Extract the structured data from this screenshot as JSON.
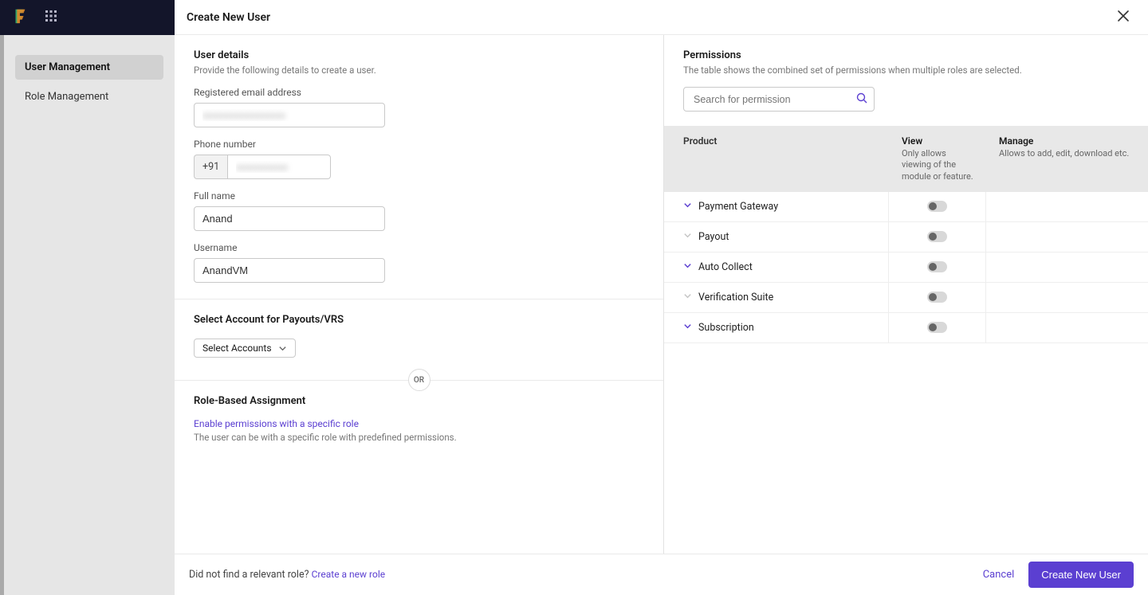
{
  "sidebar": {
    "items": [
      {
        "label": "User Management",
        "active": true
      },
      {
        "label": "Role Management",
        "active": false
      }
    ]
  },
  "modal": {
    "title": "Create New User",
    "left": {
      "user_details": {
        "title": "User details",
        "subtitle": "Provide the following details to create a user.",
        "email_label": "Registered email address",
        "email_value": "xxxxxxxxxxxxxxxx",
        "phone_label": "Phone number",
        "phone_prefix": "+91",
        "phone_value": "xxxxxxxxxx",
        "fullname_label": "Full name",
        "fullname_value": "Anand",
        "username_label": "Username",
        "username_value": "AnandVM"
      },
      "accounts": {
        "title": "Select Account for Payouts/VRS",
        "select_label": "Select Accounts"
      },
      "or_label": "OR",
      "role": {
        "title": "Role-Based Assignment",
        "link": "Enable permissions with a specific role",
        "note": "The user can be with a specific role with predefined permissions."
      }
    },
    "right": {
      "title": "Permissions",
      "subtitle": "The table shows the combined set of permissions when multiple roles are selected.",
      "search_placeholder": "Search for permission",
      "columns": {
        "product": "Product",
        "view": "View",
        "view_sub": "Only allows viewing of the module or feature.",
        "manage": "Manage",
        "manage_sub": "Allows to add, edit, download etc."
      },
      "rows": [
        {
          "name": "Payment Gateway",
          "expandable": true
        },
        {
          "name": "Payout",
          "expandable": false
        },
        {
          "name": "Auto Collect",
          "expandable": true
        },
        {
          "name": "Verification Suite",
          "expandable": false
        },
        {
          "name": "Subscription",
          "expandable": true
        }
      ]
    },
    "footer": {
      "left_text": "Did not find a relevant role? ",
      "left_link": "Create a new role",
      "cancel": "Cancel",
      "submit": "Create New User"
    }
  }
}
